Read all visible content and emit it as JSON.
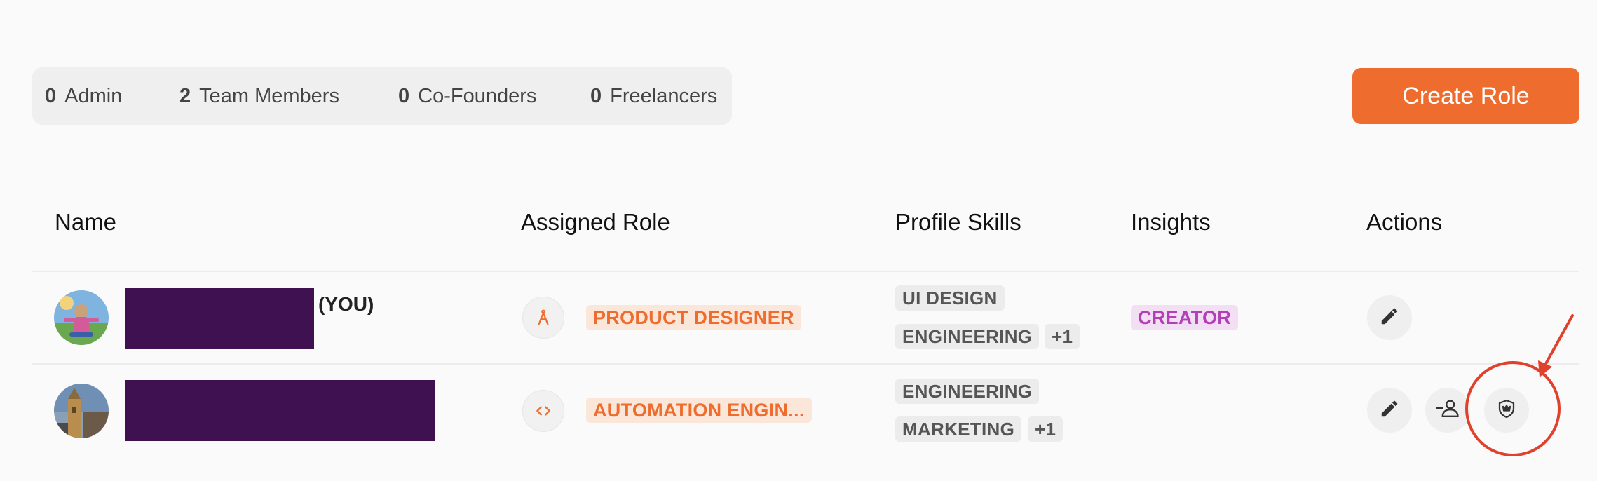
{
  "stats": [
    {
      "count": "0",
      "label": "Admin"
    },
    {
      "count": "2",
      "label": "Team Members"
    },
    {
      "count": "0",
      "label": "Co-Founders"
    },
    {
      "count": "0",
      "label": "Freelancers"
    }
  ],
  "create_role_label": "Create Role",
  "table": {
    "headers": {
      "name": "Name",
      "assigned_role": "Assigned Role",
      "profile_skills": "Profile Skills",
      "insights": "Insights",
      "actions": "Actions"
    },
    "rows": [
      {
        "you_label": "(YOU)",
        "role_icon": "compass-icon",
        "role": "PRODUCT DESIGNER",
        "skills": [
          "UI DESIGN",
          "ENGINEERING"
        ],
        "skills_more": "+1",
        "insight": "CREATOR",
        "actions": [
          "edit-icon"
        ]
      },
      {
        "role_icon": "code-icon",
        "role": "AUTOMATION ENGIN...",
        "skills": [
          "ENGINEERING",
          "MARKETING"
        ],
        "skills_more": "+1",
        "actions": [
          "edit-icon",
          "remove-user-icon",
          "shield-crown-icon"
        ]
      }
    ]
  },
  "colors": {
    "accent": "#ee6d2e",
    "redaction": "#3f1150",
    "insight": "#b23fb8",
    "annotation": "#e0412c"
  }
}
